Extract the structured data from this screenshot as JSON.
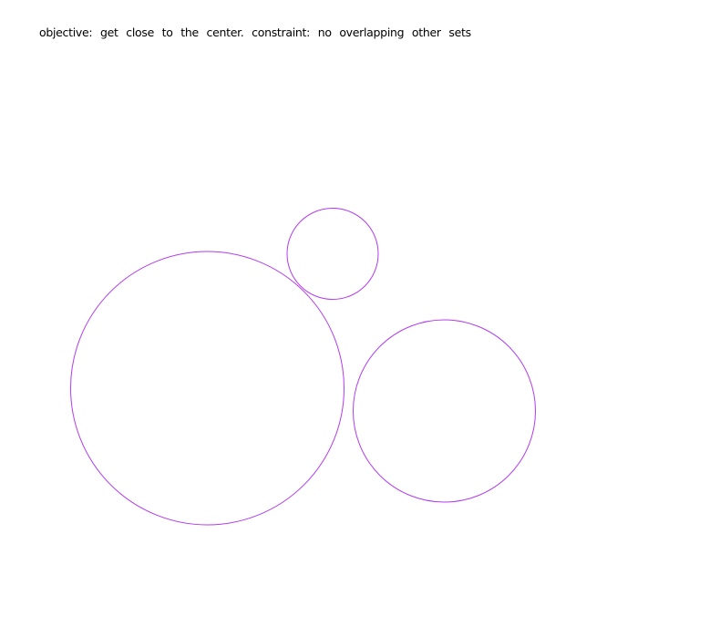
{
  "objective_text": "objective: get close to the center. constraint: no overlapping other sets",
  "circle_color": "#b23cf0",
  "circles": [
    {
      "id": "small"
    },
    {
      "id": "large"
    },
    {
      "id": "medium"
    }
  ]
}
